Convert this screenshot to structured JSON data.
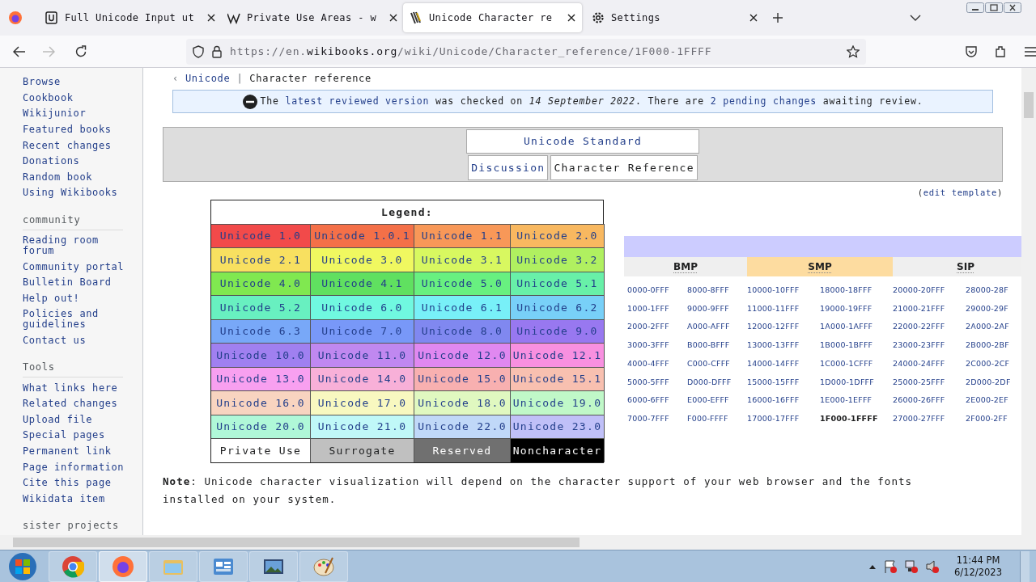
{
  "browser": {
    "tabs": [
      {
        "title": "Full Unicode Input ut",
        "kind": "unicode",
        "selected": false
      },
      {
        "title": "Private Use Areas - w",
        "kind": "wiki",
        "selected": false
      },
      {
        "title": "Unicode Character re",
        "kind": "wikibooks",
        "selected": true
      },
      {
        "title": "Settings",
        "kind": "settings",
        "selected": false
      }
    ],
    "address": "https://en.**wikibooks.org**/wiki/Unicode/Character_reference/1F000-1FFFF"
  },
  "sidebar": {
    "groups": [
      {
        "items": [
          "Browse",
          "Cookbook",
          "Wikijunior",
          "Featured books",
          "Recent changes",
          "Donations",
          "Random book",
          "Using Wikibooks"
        ]
      },
      {
        "heading": "community",
        "items": [
          "Reading room forum",
          "Community portal",
          "Bulletin Board",
          "Help out!",
          "Policies and guidelines",
          "Contact us"
        ]
      },
      {
        "heading": "Tools",
        "items": [
          "What links here",
          "Related changes",
          "Upload file",
          "Special pages",
          "Permanent link",
          "Page information",
          "Cite this page",
          "Wikidata item"
        ]
      },
      {
        "heading": "sister projects"
      }
    ]
  },
  "breadcrumb": {
    "mark": "‹",
    "parent": "Unicode",
    "separator": "|",
    "current": "Character reference"
  },
  "notice": {
    "segments": [
      {
        "text": "The "
      },
      {
        "link": "latest reviewed version"
      },
      {
        "text": " was checked on *14 September 2022*. There are "
      },
      {
        "link": "2 pending changes"
      },
      {
        "text": " awaiting review."
      }
    ]
  },
  "nav_box": {
    "title": "Unicode Standard",
    "links": [
      {
        "label": "Discussion",
        "selected": false
      },
      {
        "label": "Character Reference",
        "selected": true
      }
    ]
  },
  "edit_template": {
    "open": "(",
    "link": "edit template",
    "close": ")"
  },
  "legend": {
    "title": "Legend:",
    "cells": [
      {
        "label": "Unicode 1.0",
        "kind": "version",
        "color": "#f24a4a"
      },
      {
        "label": "Unicode 1.0.1",
        "kind": "version",
        "color": "#f47048"
      },
      {
        "label": "Unicode 1.1",
        "kind": "version",
        "color": "#f89858"
      },
      {
        "label": "Unicode 2.0",
        "kind": "version",
        "color": "#f8b860"
      },
      {
        "label": "Unicode 2.1",
        "kind": "version",
        "color": "#f8e060"
      },
      {
        "label": "Unicode 3.0",
        "kind": "version",
        "color": "#f0f860"
      },
      {
        "label": "Unicode 3.1",
        "kind": "version",
        "color": "#d8f860"
      },
      {
        "label": "Unicode 3.2",
        "kind": "version",
        "color": "#b0f060"
      },
      {
        "label": "Unicode 4.0",
        "kind": "version",
        "color": "#80e850"
      },
      {
        "label": "Unicode 4.1",
        "kind": "version",
        "color": "#60e060"
      },
      {
        "label": "Unicode 5.0",
        "kind": "version",
        "color": "#68f080"
      },
      {
        "label": "Unicode 5.1",
        "kind": "version",
        "color": "#68f0a8"
      },
      {
        "label": "Unicode 5.2",
        "kind": "version",
        "color": "#68f0c0"
      },
      {
        "label": "Unicode 6.0",
        "kind": "version",
        "color": "#70f8e0"
      },
      {
        "label": "Unicode 6.1",
        "kind": "version",
        "color": "#78f0f8"
      },
      {
        "label": "Unicode 6.2",
        "kind": "version",
        "color": "#78d0f8"
      },
      {
        "label": "Unicode 6.3",
        "kind": "version",
        "color": "#78a8f8"
      },
      {
        "label": "Unicode 7.0",
        "kind": "version",
        "color": "#7898f8"
      },
      {
        "label": "Unicode 8.0",
        "kind": "version",
        "color": "#8088f0"
      },
      {
        "label": "Unicode 9.0",
        "kind": "version",
        "color": "#9878f0"
      },
      {
        "label": "Unicode 10.0",
        "kind": "version",
        "color": "#a080f0"
      },
      {
        "label": "Unicode 11.0",
        "kind": "version",
        "color": "#c088f0"
      },
      {
        "label": "Unicode 12.0",
        "kind": "version",
        "color": "#e088f0"
      },
      {
        "label": "Unicode 12.1",
        "kind": "version",
        "color": "#f890e0"
      },
      {
        "label": "Unicode 13.0",
        "kind": "version",
        "color": "#f8a0f0"
      },
      {
        "label": "Unicode 14.0",
        "kind": "version",
        "color": "#f8b0d8"
      },
      {
        "label": "Unicode 15.0",
        "kind": "version",
        "color": "#f8b0b0"
      },
      {
        "label": "Unicode 15.1",
        "kind": "version",
        "color": "#f8c0b0"
      },
      {
        "label": "Unicode 16.0",
        "kind": "version",
        "color": "#f8d4c0"
      },
      {
        "label": "Unicode 17.0",
        "kind": "version",
        "color": "#f8f8c0"
      },
      {
        "label": "Unicode 18.0",
        "kind": "version",
        "color": "#e0f8c0"
      },
      {
        "label": "Unicode 19.0",
        "kind": "version",
        "color": "#c0f8c8"
      },
      {
        "label": "Unicode 20.0",
        "kind": "version",
        "color": "#b0f8d8"
      },
      {
        "label": "Unicode 21.0",
        "kind": "version",
        "color": "#c0f8f8"
      },
      {
        "label": "Unicode 22.0",
        "kind": "version",
        "color": "#c0d8f8"
      },
      {
        "label": "Unicode 23.0",
        "kind": "version",
        "color": "#c0c0f8"
      },
      {
        "label": "Private Use",
        "kind": "category",
        "color": "#ffffff"
      },
      {
        "label": "Surrogate",
        "kind": "category",
        "color": "#c0c0c0"
      },
      {
        "label": "Reserved",
        "kind": "category",
        "color": "#707070"
      },
      {
        "label": "Noncharacter",
        "kind": "category",
        "color": "#000000"
      }
    ]
  },
  "planes": {
    "columns": [
      {
        "label": "BMP",
        "selected": false
      },
      {
        "label": "SMP",
        "selected": true
      },
      {
        "label": "SIP",
        "selected": false
      }
    ],
    "rows": [
      [
        {
          "text": "0000-0FFF",
          "selected": false
        },
        {
          "text": "8000-8FFF",
          "selected": false
        },
        {
          "text": "10000-10FFF",
          "selected": false
        },
        {
          "text": "18000-18FFF",
          "selected": false
        },
        {
          "text": "20000-20FFF",
          "selected": false
        },
        {
          "text": "28000-28F",
          "selected": false
        }
      ],
      [
        {
          "text": "1000-1FFF",
          "selected": false
        },
        {
          "text": "9000-9FFF",
          "selected": false
        },
        {
          "text": "11000-11FFF",
          "selected": false
        },
        {
          "text": "19000-19FFF",
          "selected": false
        },
        {
          "text": "21000-21FFF",
          "selected": false
        },
        {
          "text": "29000-29F",
          "selected": false
        }
      ],
      [
        {
          "text": "2000-2FFF",
          "selected": false
        },
        {
          "text": "A000-AFFF",
          "selected": false
        },
        {
          "text": "12000-12FFF",
          "selected": false
        },
        {
          "text": "1A000-1AFFF",
          "selected": false
        },
        {
          "text": "22000-22FFF",
          "selected": false
        },
        {
          "text": "2A000-2AF",
          "selected": false
        }
      ],
      [
        {
          "text": "3000-3FFF",
          "selected": false
        },
        {
          "text": "B000-BFFF",
          "selected": false
        },
        {
          "text": "13000-13FFF",
          "selected": false
        },
        {
          "text": "1B000-1BFFF",
          "selected": false
        },
        {
          "text": "23000-23FFF",
          "selected": false
        },
        {
          "text": "2B000-2BF",
          "selected": false
        }
      ],
      [
        {
          "text": "4000-4FFF",
          "selected": false
        },
        {
          "text": "C000-CFFF",
          "selected": false
        },
        {
          "text": "14000-14FFF",
          "selected": false
        },
        {
          "text": "1C000-1CFFF",
          "selected": false
        },
        {
          "text": "24000-24FFF",
          "selected": false
        },
        {
          "text": "2C000-2CF",
          "selected": false
        }
      ],
      [
        {
          "text": "5000-5FFF",
          "selected": false
        },
        {
          "text": "D000-DFFF",
          "selected": false
        },
        {
          "text": "15000-15FFF",
          "selected": false
        },
        {
          "text": "1D000-1DFFF",
          "selected": false
        },
        {
          "text": "25000-25FFF",
          "selected": false
        },
        {
          "text": "2D000-2DF",
          "selected": false
        }
      ],
      [
        {
          "text": "6000-6FFF",
          "selected": false
        },
        {
          "text": "E000-EFFF",
          "selected": false
        },
        {
          "text": "16000-16FFF",
          "selected": false
        },
        {
          "text": "1E000-1EFFF",
          "selected": false
        },
        {
          "text": "26000-26FFF",
          "selected": false
        },
        {
          "text": "2E000-2EF",
          "selected": false
        }
      ],
      [
        {
          "text": "7000-7FFF",
          "selected": false
        },
        {
          "text": "F000-FFFF",
          "selected": false
        },
        {
          "text": "17000-17FFF",
          "selected": false
        },
        {
          "text": "1F000-1FFFF",
          "selected": true
        },
        {
          "text": "27000-27FFF",
          "selected": false
        },
        {
          "text": "2F000-2FF",
          "selected": false
        }
      ]
    ]
  },
  "note": "**Note**: Unicode character visualization will depend on the character support of your web browser and the fonts installed on your system.",
  "taskbar": {
    "apps": [
      {
        "kind": "chrome",
        "active": false
      },
      {
        "kind": "firefox",
        "active": true
      },
      {
        "kind": "folder",
        "active": false
      },
      {
        "kind": "control-panel",
        "active": false
      },
      {
        "kind": "photo",
        "active": false
      },
      {
        "kind": "paint",
        "active": false
      }
    ],
    "clock": {
      "time": "11:44 PM",
      "date": "6/12/2023"
    }
  }
}
